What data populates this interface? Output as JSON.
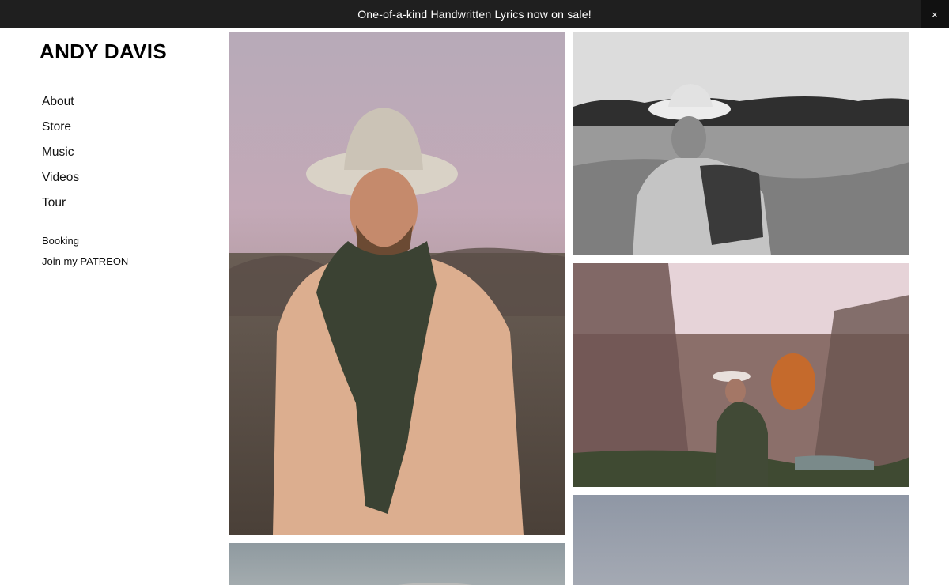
{
  "banner": {
    "text": "One-of-a-kind Handwritten Lyrics now on sale!",
    "close_label": "×"
  },
  "site": {
    "title": "ANDY DAVIS"
  },
  "nav": {
    "primary": [
      "About",
      "Store",
      "Music",
      "Videos",
      "Tour"
    ],
    "secondary": [
      "Booking",
      "Join my PATREON"
    ]
  },
  "colors": {
    "banner_bg": "#1f1f1f",
    "page_bg": "#ffffff",
    "text": "#111111"
  }
}
